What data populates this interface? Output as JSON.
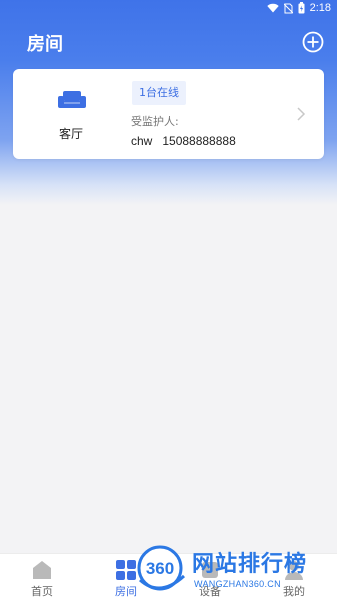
{
  "status_bar": {
    "time": "2:18"
  },
  "header": {
    "title": "房间"
  },
  "room_card": {
    "room_name": "客厅",
    "online_badge": "1台在线",
    "guardian_label": "受监护人:",
    "guardian_name": "chw",
    "guardian_phone": "15088888888"
  },
  "tabs": [
    {
      "label": "首页",
      "icon": "home-icon",
      "active": false
    },
    {
      "label": "房间",
      "icon": "rooms-grid-icon",
      "active": true
    },
    {
      "label": "设备",
      "icon": "device-icon",
      "active": false
    },
    {
      "label": "我的",
      "icon": "profile-icon",
      "active": false
    }
  ],
  "watermark": {
    "logo": "360",
    "text": "网站排行榜",
    "subtext": "WANGZHAN360.CN"
  },
  "colors": {
    "accent": "#3d6fe3",
    "header_bg": "#4a7eec",
    "page_bg": "#f3f3f5"
  }
}
